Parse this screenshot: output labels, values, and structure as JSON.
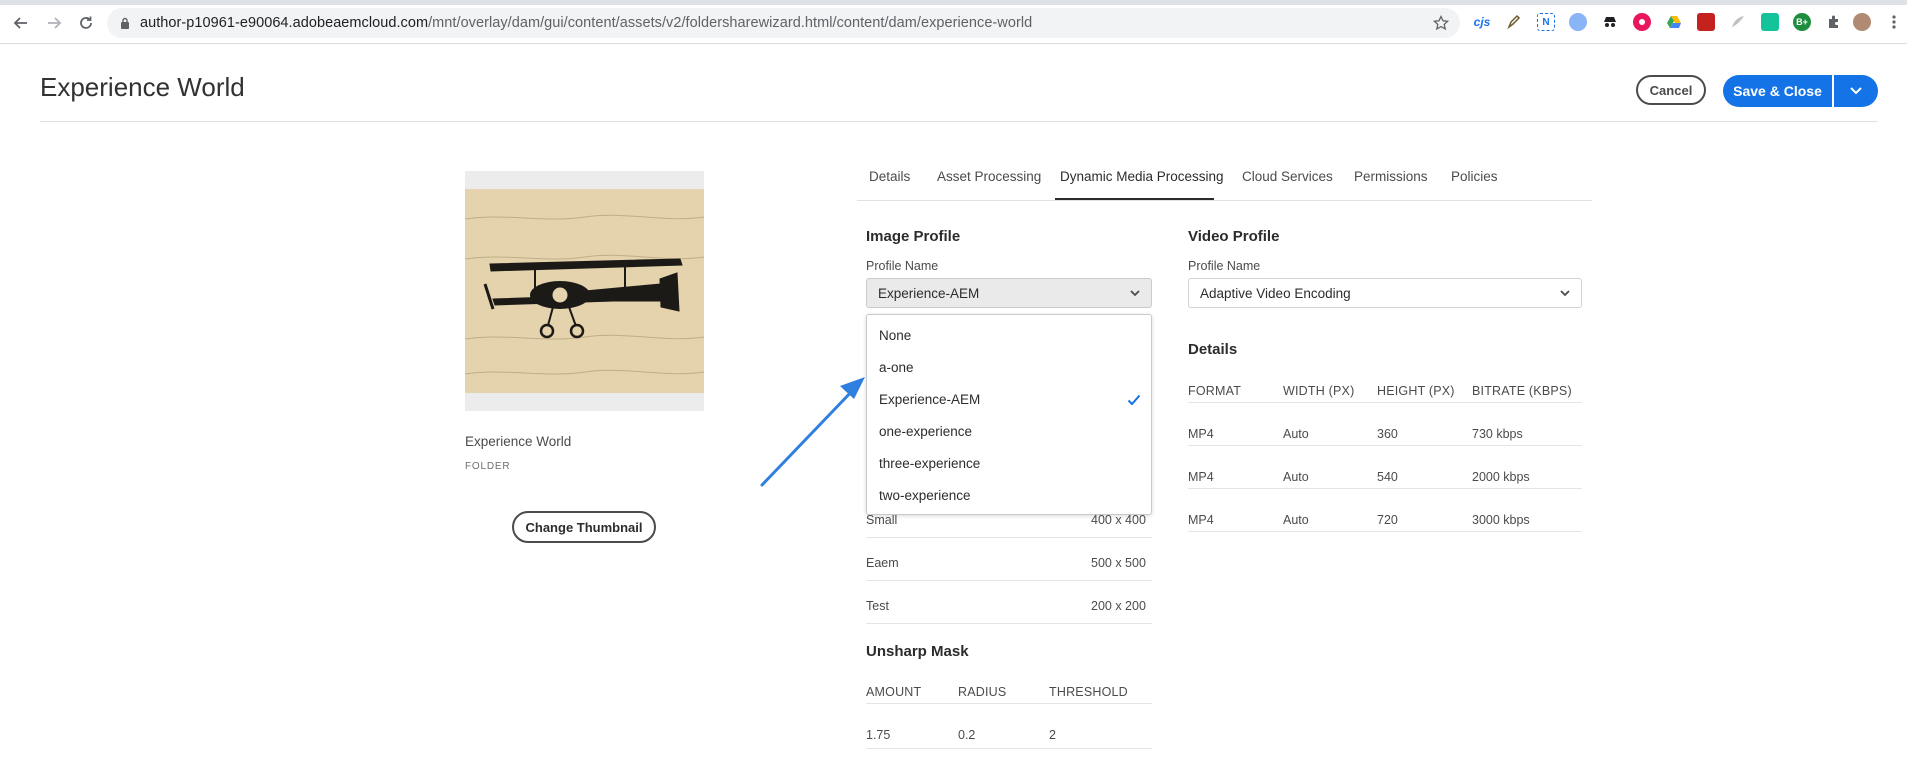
{
  "browser": {
    "url_host": "author-p10961-e90064.adobeaemcloud.com",
    "url_path": "/mnt/overlay/dam/gui/content/assets/v2/foldersharewizard.html/content/dam/experience-world",
    "extension_cjs": "cjs",
    "extension_n": "N",
    "extension_b": "B+"
  },
  "header": {
    "title": "Experience World",
    "cancel_label": "Cancel",
    "save_label": "Save & Close"
  },
  "card": {
    "title": "Experience World",
    "type": "FOLDER",
    "change_thumbnail_label": "Change Thumbnail"
  },
  "tabs": [
    {
      "label": "Details"
    },
    {
      "label": "Asset Processing"
    },
    {
      "label": "Dynamic Media Processing"
    },
    {
      "label": "Cloud Services"
    },
    {
      "label": "Permissions"
    },
    {
      "label": "Policies"
    }
  ],
  "image_profile": {
    "heading": "Image Profile",
    "profile_name_label": "Profile Name",
    "selected": "Experience-AEM",
    "options": [
      "None",
      "a-one",
      "Experience-AEM",
      "one-experience",
      "three-experience",
      "two-experience"
    ],
    "renditions": [
      {
        "name": "Small",
        "size": "400 x 400"
      },
      {
        "name": "Eaem",
        "size": "500 x 500"
      },
      {
        "name": "Test",
        "size": "200 x 200"
      }
    ],
    "unsharp_mask": {
      "heading": "Unsharp Mask",
      "headers": [
        "AMOUNT",
        "RADIUS",
        "THRESHOLD"
      ],
      "values": [
        "1.75",
        "0.2",
        "2"
      ]
    }
  },
  "video_profile": {
    "heading": "Video Profile",
    "profile_name_label": "Profile Name",
    "selected": "Adaptive Video Encoding",
    "details_heading": "Details",
    "headers": [
      "FORMAT",
      "WIDTH (PX)",
      "HEIGHT (PX)",
      "BITRATE (KBPS)"
    ],
    "rows": [
      [
        "MP4",
        "Auto",
        "360",
        "730 kbps"
      ],
      [
        "MP4",
        "Auto",
        "540",
        "2000 kbps"
      ],
      [
        "MP4",
        "Auto",
        "720",
        "3000 kbps"
      ]
    ]
  },
  "colors": {
    "accent": "#1473e6",
    "annotation_arrow": "#2f7fe0"
  }
}
